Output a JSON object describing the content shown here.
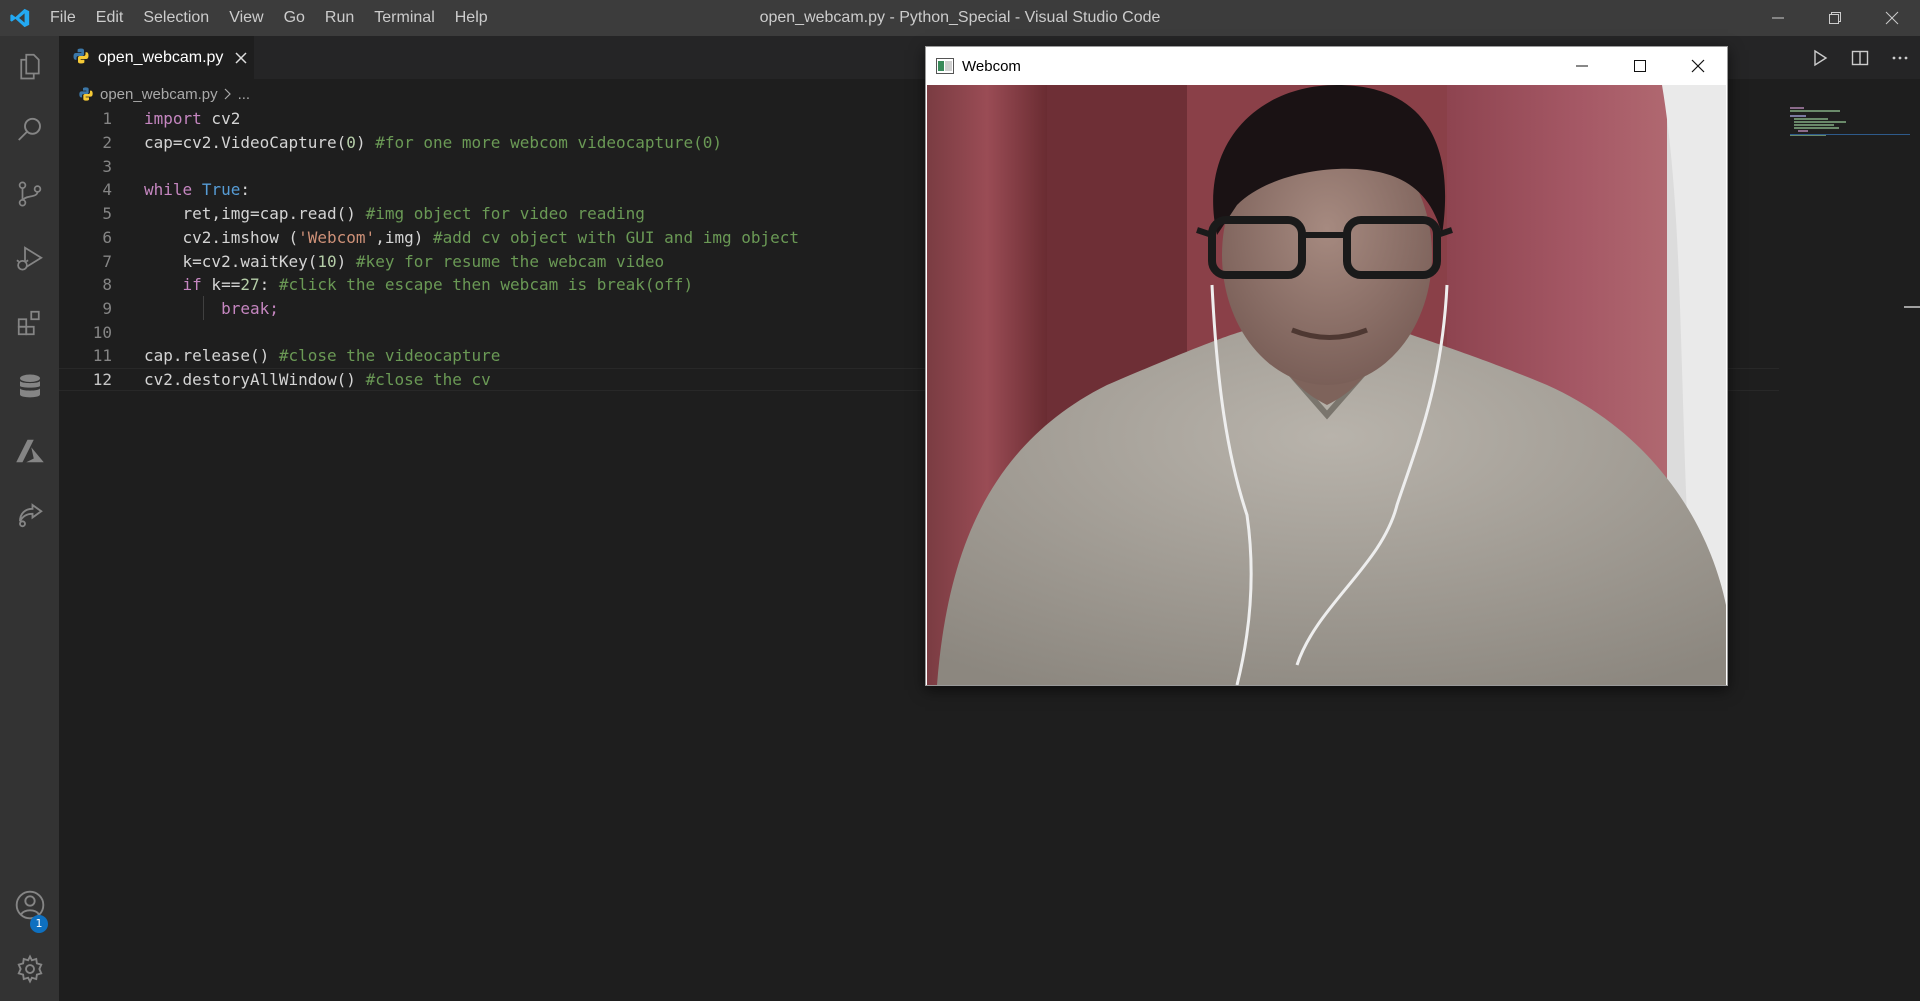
{
  "window": {
    "title": "open_webcam.py - Python_Special - Visual Studio Code",
    "menu": [
      "File",
      "Edit",
      "Selection",
      "View",
      "Go",
      "Run",
      "Terminal",
      "Help"
    ]
  },
  "activity_bar": {
    "items": [
      "explorer-icon",
      "search-icon",
      "source-control-icon",
      "run-debug-icon",
      "extensions-icon",
      "database-icon",
      "azure-icon",
      "live-share-icon"
    ],
    "accounts_badge": "1"
  },
  "tabs": [
    {
      "label": "open_webcam.py",
      "active": true
    }
  ],
  "breadcrumb": {
    "file": "open_webcam.py",
    "more": "..."
  },
  "editor": {
    "line_numbers": [
      "1",
      "2",
      "3",
      "4",
      "5",
      "6",
      "7",
      "8",
      "9",
      "10",
      "11",
      "12"
    ],
    "lines": {
      "l1_kw": "import",
      "l1_rest": " cv2",
      "l2_code": "cap=cv2.VideoCapture(",
      "l2_num": "0",
      "l2_close": ") ",
      "l2_comment": "#for one more webcom videocapture(0)",
      "l4_kw": "while",
      "l4_true": "True",
      "l4_colon": ":",
      "l5_code": "    ret,img=cap.read() ",
      "l5_comment": "#img object for video reading",
      "l6_code1": "    cv2.imshow (",
      "l6_str": "'Webcom'",
      "l6_code2": ",img) ",
      "l6_comment": "#add cv object with GUI and img object",
      "l7_code1": "    k=cv2.waitKey(",
      "l7_num": "10",
      "l7_code2": ") ",
      "l7_comment": "#key for resume the webcam video",
      "l8_kw": "    if",
      "l8_code": " k==",
      "l8_num": "27",
      "l8_colon": ": ",
      "l8_comment": "#click the escape then webcam is break(off)",
      "l9_kw": "        break",
      "l9_semi": ";",
      "l11_code": "cap.release() ",
      "l11_comment": "#close the videocapture",
      "l12_code": "cv2.destoryAllWindow() ",
      "l12_comment": "#close the cv"
    }
  },
  "webcam_window": {
    "title": "Webcom"
  },
  "colors": {
    "keyword": "#c586c0",
    "builtin": "#569cd6",
    "comment": "#6a9955",
    "string": "#ce9178",
    "number": "#b5cea8"
  }
}
